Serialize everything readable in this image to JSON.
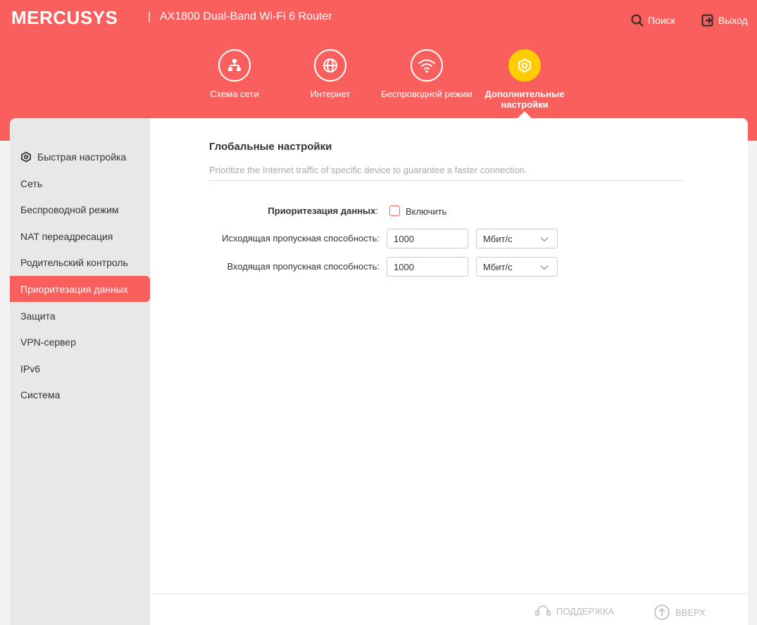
{
  "header": {
    "brand": "MERCUSYS",
    "separator": "|",
    "model": "AX1800 Dual-Band Wi-Fi 6 Router",
    "search_label": "Поиск",
    "logout_label": "Выход",
    "accent_color": "#f95f5d"
  },
  "nav": {
    "items": [
      {
        "label": "Схема сети",
        "icon": "network-map-icon",
        "active": false
      },
      {
        "label": "Интернет",
        "icon": "globe-icon",
        "active": false
      },
      {
        "label": "Беспроводной режим",
        "icon": "wifi-icon",
        "active": false
      },
      {
        "label": "Дополнительные настройки",
        "icon": "gear-icon",
        "active": true
      }
    ],
    "active_color": "#ffcc00"
  },
  "sidebar": {
    "items": [
      {
        "label": "Быстрая настройка",
        "icon": "quick-setup-icon",
        "active": false
      },
      {
        "label": "Сеть",
        "active": false
      },
      {
        "label": "Беспроводной режим",
        "active": false
      },
      {
        "label": "NAT переадресация",
        "active": false
      },
      {
        "label": "Родительский контроль",
        "active": false
      },
      {
        "label": "Приоритезация данных",
        "active": true
      },
      {
        "label": "Защита",
        "active": false
      },
      {
        "label": "VPN-сервер",
        "active": false
      },
      {
        "label": "IPv6",
        "active": false
      },
      {
        "label": "Система",
        "active": false
      }
    ]
  },
  "main": {
    "section_title": "Глобальные настройки",
    "section_desc": "Prioritize the Internet traffic of specific device to guarantee a faster connection.",
    "priority": {
      "label": "Приоритезация данных",
      "colon": ":",
      "checkbox_label": "Включить",
      "checked": false
    },
    "upload": {
      "label": "Исходящая пропускная способность:",
      "value": "1000",
      "unit": "Мбит/с"
    },
    "download": {
      "label": "Входящая пропускная способность:",
      "value": "1000",
      "unit": "Мбит/с"
    }
  },
  "footer": {
    "support_label": "ПОДДЕРЖКА",
    "top_label": "ВВЕРХ"
  }
}
